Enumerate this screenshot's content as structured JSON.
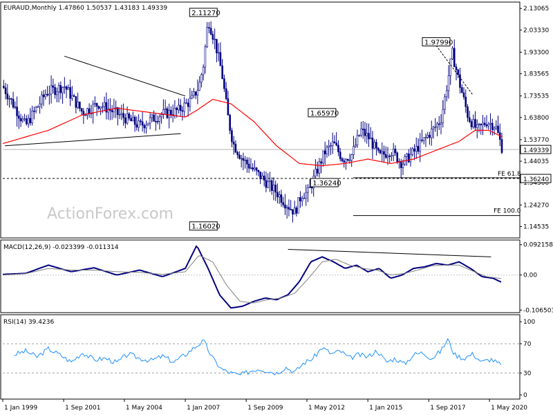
{
  "watermark": "ActionForex.com",
  "chart_data": [
    {
      "type": "candlestick",
      "title": "EURAUD,Monthly  1.47860 1.50537 1.43183 1.49339",
      "ylim": [
        1.1,
        2.15
      ],
      "yticks": [
        "2.13065",
        "2.03330",
        "1.93300",
        "1.83565",
        "1.73535",
        "1.63800",
        "1.53770",
        "1.44035",
        "1.34300",
        "1.24270",
        "1.14535"
      ],
      "yticks_values": [
        2.13065,
        2.0333,
        1.933,
        1.83565,
        1.73535,
        1.638,
        1.5377,
        1.44035,
        1.343,
        1.2427,
        1.14535
      ],
      "xticks": [
        "1 Jan 1999",
        "1 Sep 2001",
        "1 May 2004",
        "1 Jan 2007",
        "1 Sep 2009",
        "1 May 2012",
        "1 Jan 2015",
        "1 Sep 2017",
        "1 May 2020"
      ],
      "xticks_values": [
        1999.0,
        2001.67,
        2004.33,
        2007.0,
        2009.67,
        2012.33,
        2015.0,
        2017.67,
        2020.33
      ],
      "last_price": "1.49339",
      "last_price_value": 1.49339,
      "fe_levels": [
        {
          "label": "FE 61.8",
          "value": 1.3624,
          "tag": "1.36240"
        },
        {
          "label": "FE 100.0",
          "value": 1.195
        }
      ],
      "annotations": [
        {
          "text": "2.11270",
          "x": 2008.4,
          "y": 2.1127
        },
        {
          "text": "1.97990",
          "x": 2018.6,
          "y": 1.9799
        },
        {
          "text": "1.65970",
          "x": 2013.6,
          "y": 1.6597
        },
        {
          "text": "1.36240",
          "x": 2013.7,
          "y": 1.3624
        },
        {
          "text": "1.16020",
          "x": 2008.4,
          "y": 1.1602
        }
      ],
      "trendlines": [
        {
          "from": [
            1999.1,
            1.51
          ],
          "to": [
            2006.8,
            1.565
          ]
        },
        {
          "from": [
            2001.7,
            1.915
          ],
          "to": [
            2007.0,
            1.735
          ]
        },
        {
          "from": [
            2017.9,
            1.976
          ],
          "to": [
            2019.6,
            1.74
          ]
        }
      ],
      "ma_color": "#ff0000",
      "up_color": "#000080",
      "down_color": "#000080",
      "series": [
        {
          "name": "close",
          "x": [
            1999.0,
            2000.0,
            2000.9,
            2001.7,
            2002.5,
            2003.2,
            2004.1,
            2005.0,
            2005.9,
            2006.7,
            2007.3,
            2007.6,
            2007.8,
            2008.0,
            2008.3,
            2008.6,
            2008.9,
            2009.1,
            2009.5,
            2010.0,
            2010.5,
            2011.0,
            2011.4,
            2011.8,
            2012.1,
            2012.4,
            2012.7,
            2013.1,
            2013.5,
            2013.9,
            2014.3,
            2014.7,
            2015.1,
            2015.5,
            2016.0,
            2016.5,
            2017.0,
            2017.5,
            2018.0,
            2018.2,
            2018.4,
            2018.7,
            2019.0,
            2019.4,
            2019.8,
            2020.2,
            2020.6,
            2020.9
          ],
          "values": [
            1.78,
            1.6,
            1.75,
            1.78,
            1.66,
            1.7,
            1.65,
            1.6,
            1.65,
            1.67,
            1.72,
            1.78,
            1.88,
            2.08,
            1.98,
            1.84,
            1.62,
            1.52,
            1.45,
            1.4,
            1.35,
            1.3,
            1.25,
            1.21,
            1.29,
            1.3,
            1.38,
            1.48,
            1.52,
            1.45,
            1.47,
            1.58,
            1.54,
            1.46,
            1.49,
            1.43,
            1.48,
            1.54,
            1.6,
            1.63,
            1.74,
            1.93,
            1.8,
            1.64,
            1.58,
            1.62,
            1.6,
            1.49339
          ]
        },
        {
          "name": "ma",
          "x": [
            1999.0,
            2001.0,
            2002.5,
            2004.0,
            2005.5,
            2007.0,
            2007.5,
            2008.2,
            2009.0,
            2010.0,
            2011.0,
            2012.0,
            2013.0,
            2014.0,
            2015.0,
            2016.0,
            2017.0,
            2018.0,
            2019.0,
            2019.7,
            2020.3,
            2020.9
          ],
          "values": [
            1.52,
            1.58,
            1.65,
            1.68,
            1.66,
            1.64,
            1.67,
            1.72,
            1.7,
            1.62,
            1.51,
            1.43,
            1.42,
            1.43,
            1.45,
            1.43,
            1.45,
            1.49,
            1.53,
            1.58,
            1.58,
            1.55
          ]
        }
      ]
    },
    {
      "type": "line",
      "title": "MACD(12,26,9) -0.023399 -0.011314",
      "ylim": [
        -0.11,
        0.1
      ],
      "yticks": [
        "0.092158",
        "0.00",
        "-0.106503"
      ],
      "yticks_values": [
        0.092158,
        0.0,
        -0.106503
      ],
      "series": [
        {
          "name": "macd",
          "color": "#000080",
          "x": [
            1999.0,
            2000.0,
            2001.0,
            2002.0,
            2003.0,
            2004.0,
            2005.0,
            2006.0,
            2007.0,
            2007.5,
            2008.0,
            2008.5,
            2009.0,
            2009.5,
            2010.0,
            2010.5,
            2011.0,
            2011.5,
            2012.0,
            2012.5,
            2013.0,
            2013.5,
            2014.0,
            2014.5,
            2015.0,
            2015.5,
            2016.0,
            2016.5,
            2017.0,
            2017.5,
            2018.0,
            2018.5,
            2019.0,
            2019.5,
            2020.0,
            2020.5,
            2020.9
          ],
          "values": [
            0.002,
            0.005,
            0.03,
            0.01,
            0.022,
            0.0,
            0.015,
            -0.005,
            0.02,
            0.09,
            0.02,
            -0.06,
            -0.1,
            -0.095,
            -0.08,
            -0.07,
            -0.075,
            -0.06,
            -0.02,
            0.04,
            0.055,
            0.04,
            0.02,
            0.03,
            0.01,
            0.02,
            -0.01,
            0.0,
            0.02,
            0.025,
            0.035,
            0.03,
            0.04,
            0.02,
            -0.005,
            -0.01,
            -0.023399
          ]
        },
        {
          "name": "signal",
          "color": "#808080",
          "x": [
            1999.0,
            2000.0,
            2001.0,
            2002.0,
            2003.0,
            2004.0,
            2005.0,
            2006.0,
            2007.0,
            2007.6,
            2008.2,
            2008.8,
            2009.4,
            2010.0,
            2010.6,
            2011.2,
            2011.8,
            2012.4,
            2013.0,
            2013.6,
            2014.2,
            2014.8,
            2015.4,
            2016.0,
            2016.6,
            2017.2,
            2017.8,
            2018.4,
            2019.0,
            2019.6,
            2020.2,
            2020.9
          ],
          "values": [
            0.0,
            0.004,
            0.02,
            0.015,
            0.015,
            0.01,
            0.008,
            0.002,
            0.01,
            0.06,
            0.04,
            -0.03,
            -0.08,
            -0.085,
            -0.075,
            -0.07,
            -0.055,
            -0.01,
            0.04,
            0.048,
            0.03,
            0.02,
            0.015,
            0.0,
            0.005,
            0.015,
            0.028,
            0.03,
            0.03,
            0.012,
            -0.005,
            -0.011314
          ]
        }
      ]
    },
    {
      "type": "line",
      "title": "RSI(14) 39.4236",
      "ylim": [
        0,
        100
      ],
      "yticks": [
        "100",
        "70",
        "30",
        "0"
      ],
      "yticks_values": [
        100,
        70,
        30,
        0
      ],
      "series": [
        {
          "name": "rsi",
          "color": "#1e90ff",
          "x": [
            1999.5,
            2000.0,
            2000.5,
            2001.0,
            2001.5,
            2002.0,
            2002.5,
            2003.0,
            2003.5,
            2004.0,
            2004.5,
            2005.0,
            2005.5,
            2006.0,
            2006.5,
            2007.0,
            2007.4,
            2007.8,
            2008.2,
            2008.6,
            2009.0,
            2009.4,
            2009.8,
            2010.2,
            2010.6,
            2011.0,
            2011.4,
            2011.8,
            2012.2,
            2012.6,
            2013.0,
            2013.4,
            2013.8,
            2014.2,
            2014.6,
            2015.0,
            2015.4,
            2015.8,
            2016.2,
            2016.6,
            2017.0,
            2017.4,
            2017.8,
            2018.2,
            2018.5,
            2018.8,
            2019.2,
            2019.6,
            2020.0,
            2020.4,
            2020.9
          ],
          "values": [
            55,
            60,
            52,
            63,
            55,
            45,
            58,
            48,
            50,
            44,
            56,
            50,
            47,
            53,
            45,
            55,
            65,
            74,
            50,
            35,
            30,
            27,
            32,
            36,
            33,
            30,
            38,
            31,
            44,
            50,
            65,
            56,
            60,
            50,
            55,
            52,
            61,
            45,
            50,
            42,
            55,
            58,
            50,
            60,
            76,
            55,
            50,
            56,
            45,
            49,
            39.4236
          ]
        }
      ]
    }
  ]
}
